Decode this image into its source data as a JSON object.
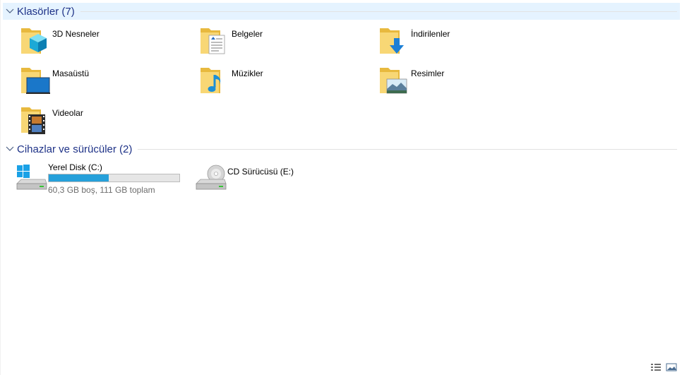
{
  "groups": {
    "folders": {
      "title": "Klasörler (7)"
    },
    "drives": {
      "title": "Cihazlar ve sürücüler (2)"
    }
  },
  "folders": [
    {
      "label": "3D Nesneler",
      "icon": "3d-objects-icon"
    },
    {
      "label": "Belgeler",
      "icon": "documents-icon"
    },
    {
      "label": "İndirilenler",
      "icon": "downloads-icon"
    },
    {
      "label": "Masaüstü",
      "icon": "desktop-icon"
    },
    {
      "label": "Müzikler",
      "icon": "music-icon"
    },
    {
      "label": "Resimler",
      "icon": "pictures-icon"
    },
    {
      "label": "Videolar",
      "icon": "videos-icon"
    }
  ],
  "drives": [
    {
      "label": "Yerel Disk (C:)",
      "info": "60,3 GB boş, 111 GB toplam",
      "used_fraction": 0.457,
      "icon": "windows-drive-icon"
    },
    {
      "label": "CD Sürücüsü (E:)",
      "icon": "cd-drive-icon"
    }
  ],
  "status_bar": {
    "details_view_icon": "details-view-icon",
    "large_icons_view_icon": "large-icons-view-icon"
  },
  "colors": {
    "header_text": "#1e3287",
    "header_bg_selected": "#e5f3ff",
    "progress_fill": "#26a0da",
    "folder_yellow": "#f8d775"
  }
}
